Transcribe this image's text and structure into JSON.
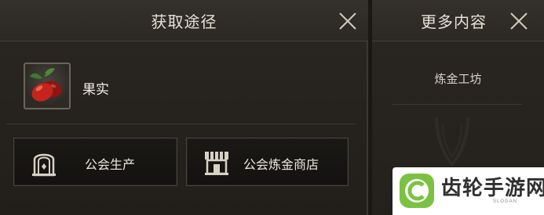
{
  "acquire_panel": {
    "title": "获取途径",
    "item": {
      "name": "果实",
      "icon": "red-fruit-icon"
    },
    "sources": [
      {
        "label": "公会生产",
        "icon": "guild-arch-icon"
      },
      {
        "label": "公会炼金商店",
        "icon": "shop-awning-icon"
      }
    ],
    "close_icon": "close-icon"
  },
  "more_panel": {
    "title": "更多内容",
    "items": [
      "炼金工坊"
    ],
    "close_icon": "close-icon"
  },
  "watermark": {
    "text": "齿轮手游网",
    "slogan": "SLOGAN",
    "accent": "#7cc242"
  },
  "colors": {
    "panel_bg": "#27241f",
    "header_bg": "#302c27",
    "text": "#e7e2d6",
    "button_bg": "#171512",
    "button_border": "#4a453d"
  }
}
